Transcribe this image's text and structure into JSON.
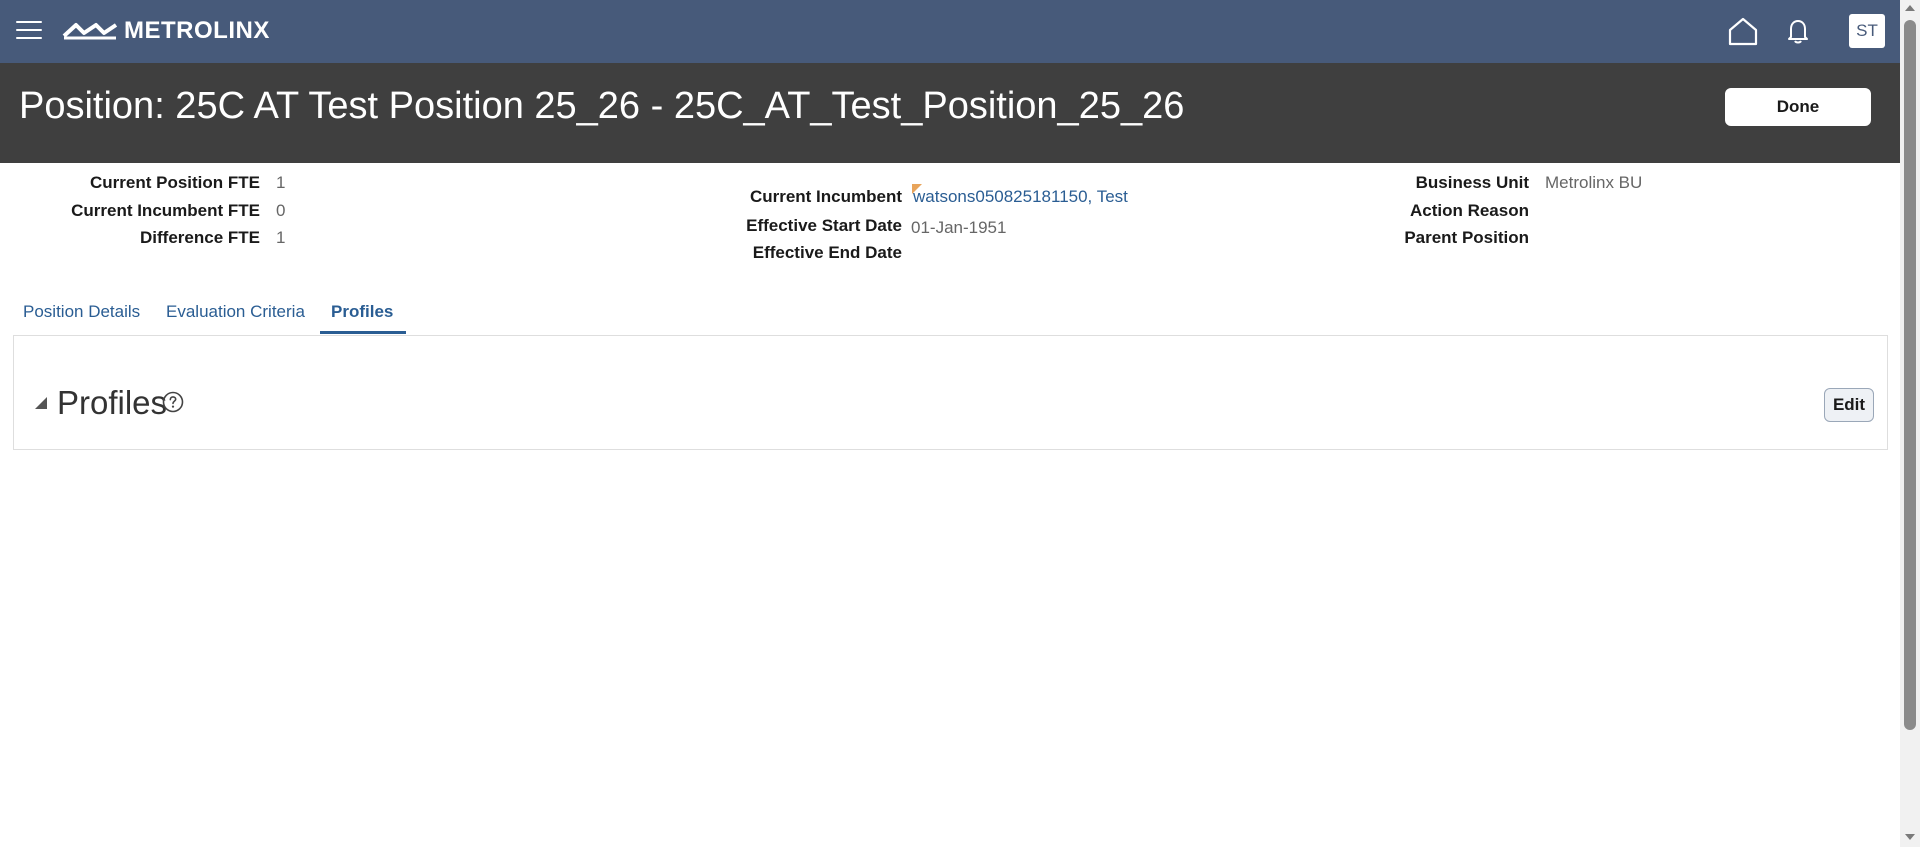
{
  "header": {
    "logo_text": "METROLINX",
    "avatar_initials": "ST",
    "icons": [
      "menu-icon",
      "home-icon",
      "bell-icon"
    ]
  },
  "title": {
    "text": "Position: 25C AT Test Position 25_26 - 25C_AT_Test_Position_25_26",
    "done_label": "Done"
  },
  "info": {
    "current_position_fte_label": "Current Position FTE",
    "current_position_fte_value": "1",
    "current_incumbent_fte_label": "Current Incumbent FTE",
    "current_incumbent_fte_value": "0",
    "difference_fte_label": "Difference FTE",
    "difference_fte_value": "1",
    "current_incumbent_label": "Current Incumbent",
    "current_incumbent_value": "watsons050825181150, Test",
    "effective_start_label": "Effective Start Date",
    "effective_start_value": "01-Jan-1951",
    "effective_end_label": "Effective End Date",
    "business_unit_label": "Business Unit",
    "business_unit_value": "Metrolinx BU",
    "action_reason_label": "Action Reason",
    "parent_position_label": "Parent Position"
  },
  "tabs": [
    {
      "label": "Position Details",
      "active": false
    },
    {
      "label": "Evaluation Criteria",
      "active": false
    },
    {
      "label": "Profiles",
      "active": true
    }
  ],
  "profiles_section": {
    "title": "Profiles",
    "edit_label": "Edit"
  },
  "colors": {
    "topbar": "#475a7a",
    "titlebar": "#3f3f3f",
    "link": "#2a5d93"
  }
}
